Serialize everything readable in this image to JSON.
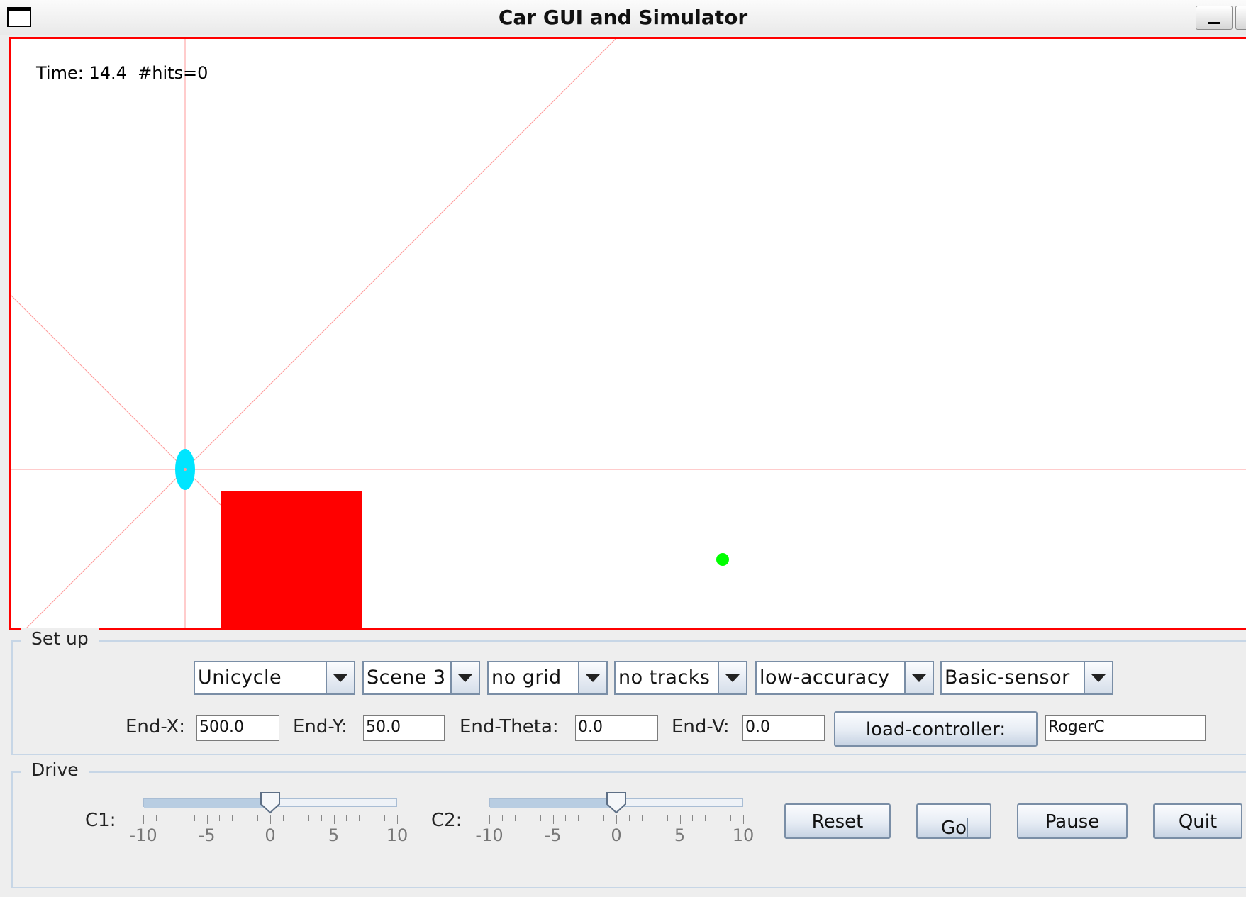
{
  "window": {
    "title": "Car GUI and Simulator"
  },
  "simulation": {
    "status_text": "Time: 14.4  #hits=0",
    "colors": {
      "border": "#ff0000",
      "obstacle": "#ff0000",
      "car": "#00e5ff",
      "target": "#00ff00",
      "sensor_rays": "#ff8a8a"
    }
  },
  "setup": {
    "title": "Set up",
    "combos": {
      "vehicle": "Unicycle",
      "scene": "Scene 3",
      "grid": "no grid",
      "tracks": "no tracks",
      "accuracy": "low-accuracy",
      "sensor": "Basic-sensor"
    },
    "fields": {
      "end_x_label": "End-X:",
      "end_x_value": "500.0",
      "end_y_label": "End-Y:",
      "end_y_value": "50.0",
      "end_theta_label": "End-Theta:",
      "end_theta_value": "0.0",
      "end_v_label": "End-V:",
      "end_v_value": "0.0"
    },
    "load_controller_label": "load-controller:",
    "controller_name": "RogerC"
  },
  "drive": {
    "title": "Drive",
    "c1_label": "C1:",
    "c2_label": "C2:",
    "slider_ticks": [
      "-10",
      "-5",
      "0",
      "5",
      "10"
    ],
    "c1_value": 0,
    "c2_value": 0,
    "buttons": {
      "reset": "Reset",
      "go": "Go",
      "pause": "Pause",
      "quit": "Quit"
    }
  }
}
